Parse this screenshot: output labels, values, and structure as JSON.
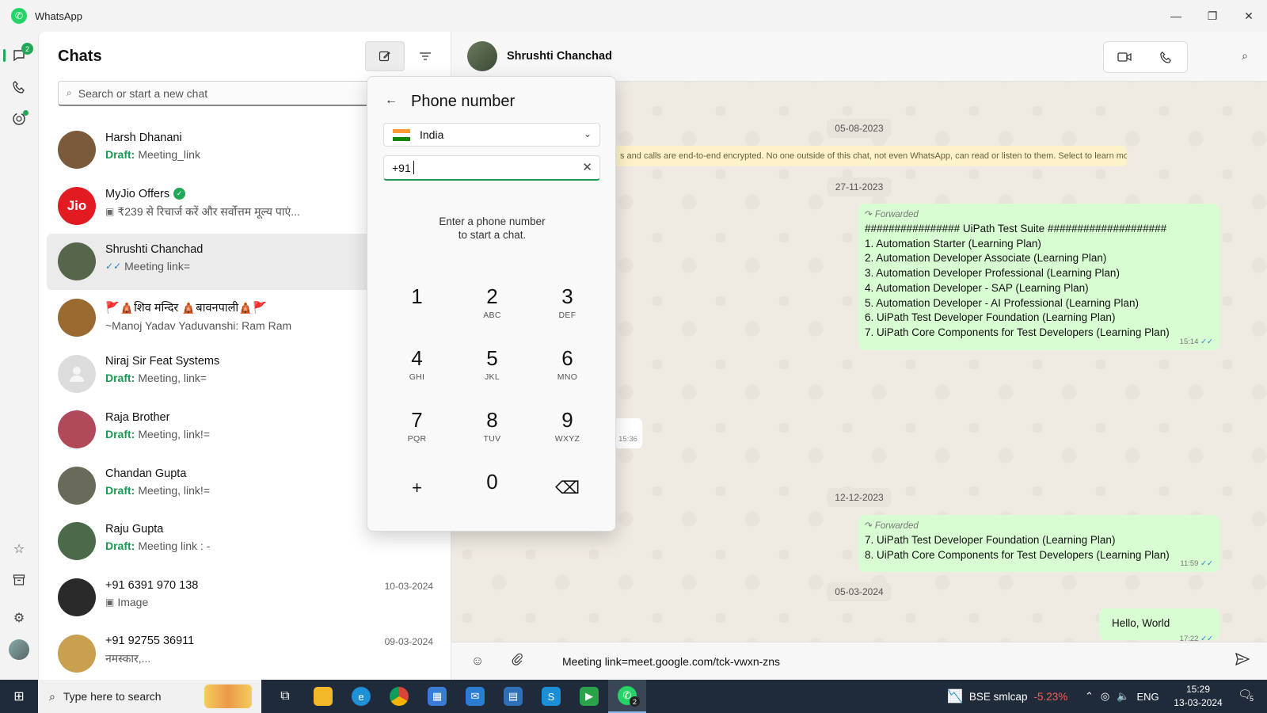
{
  "window": {
    "title": "WhatsApp",
    "controls": {
      "minimize": "—",
      "maximize": "❐",
      "close": "✕"
    }
  },
  "rail": {
    "chats_badge": "2"
  },
  "chatlist": {
    "title": "Chats",
    "search_placeholder": "Search or start a new chat",
    "chats": [
      {
        "name": "Harsh Dhanani",
        "draft": "Draft:",
        "preview": "Meeting_link",
        "date": "",
        "avatar_color": "#7a5a3a"
      },
      {
        "name": "MyJio Offers",
        "verified": true,
        "preview": "₹239 से रिचार्ज करें और सर्वोत्तम मूल्य पाएं...",
        "date": "",
        "avatar_text": "Jio",
        "avatar_color": "#e21b23"
      },
      {
        "name": "Shrushti Chanchad",
        "ticks": "✓✓",
        "preview": "Meeting  link=",
        "date": "",
        "avatar_color": "#55664a"
      },
      {
        "name": "🚩🛕शिव मन्दिर 🛕बावनपाली🛕🚩",
        "preview": "~Manoj Yadav Yaduvanshi: Ram Ram",
        "date": "",
        "avatar_color": "#9a6a30"
      },
      {
        "name": "Niraj Sir Feat Systems",
        "draft": "Draft:",
        "preview": "Meeting, link=",
        "date": "",
        "avatar_color": "#dcdcdc"
      },
      {
        "name": "Raja Brother",
        "draft": "Draft:",
        "preview": "Meeting, link!=",
        "date": "",
        "avatar_color": "#b04a5a"
      },
      {
        "name": "Chandan Gupta",
        "draft": "Draft:",
        "preview": "Meeting, link!=",
        "date": "",
        "avatar_color": "#6a6a5a"
      },
      {
        "name": "Raju Gupta",
        "draft": "Draft:",
        "preview": "Meeting link : -",
        "date": "",
        "avatar_color": "#4a6a4a"
      },
      {
        "name": "+91 6391 970 138",
        "preview": "Image",
        "date": "10-03-2024",
        "avatar_color": "#2a2a2a"
      },
      {
        "name": "+91 92755 36911",
        "preview": "नमस्कार,...",
        "date": "09-03-2024",
        "avatar_color": "#c8a050"
      }
    ]
  },
  "conversation": {
    "contact_name": "Shrushti Chanchad",
    "dates": [
      "05-08-2023",
      "27-11-2023",
      "12-12-2023",
      "05-03-2024"
    ],
    "encryption_notice": "s and calls are end-to-end encrypted. No one outside of this chat, not even WhatsApp, can read or listen to them. Select to learn more.",
    "message1": {
      "forwarded": "Forwarded",
      "lines": [
        "################ UiPath Test Suite ####################",
        "1. Automation Starter (Learning Plan)",
        "2. Automation Developer Associate (Learning Plan)",
        "3. Automation Developer Professional (Learning Plan)",
        "4. Automation Developer - SAP (Learning Plan)",
        "5. Automation Developer - AI Professional (Learning Plan)",
        "6. UiPath Test Developer Foundation (Learning Plan)",
        "7. UiPath Core Components for Test Developers (Learning Plan)"
      ],
      "time": "15:14"
    },
    "left_time": "15:36",
    "message2": {
      "forwarded": "Forwarded",
      "lines": [
        "7. UiPath Test Developer Foundation (Learning Plan)",
        "8. UiPath Core Components for Test Developers (Learning Plan)"
      ],
      "time": "11:59"
    },
    "message3": {
      "text": "Hello, World",
      "time": "17:22"
    },
    "composer_text": "Meeting  link=meet.google.com/tck-vwxn-zns"
  },
  "phone_popup": {
    "title": "Phone number",
    "country": "India",
    "input_value": "+91 ",
    "hint_line1": "Enter a phone number",
    "hint_line2": "to start a chat.",
    "keys": [
      {
        "num": "1",
        "sub": ""
      },
      {
        "num": "2",
        "sub": "ABC"
      },
      {
        "num": "3",
        "sub": "DEF"
      },
      {
        "num": "4",
        "sub": "GHI"
      },
      {
        "num": "5",
        "sub": "JKL"
      },
      {
        "num": "6",
        "sub": "MNO"
      },
      {
        "num": "7",
        "sub": "PQR"
      },
      {
        "num": "8",
        "sub": "TUV"
      },
      {
        "num": "9",
        "sub": "WXYZ"
      },
      {
        "num": "+",
        "sub": ""
      },
      {
        "num": "0",
        "sub": ""
      },
      {
        "num": "⌫",
        "sub": ""
      }
    ]
  },
  "taskbar": {
    "search_placeholder": "Type here to search",
    "whatsapp_badge": "2",
    "stock_name": "BSE smlcap",
    "stock_change": "-5.23%",
    "language": "ENG",
    "time": "15:29",
    "date": "13-03-2024",
    "notifications": "5"
  }
}
